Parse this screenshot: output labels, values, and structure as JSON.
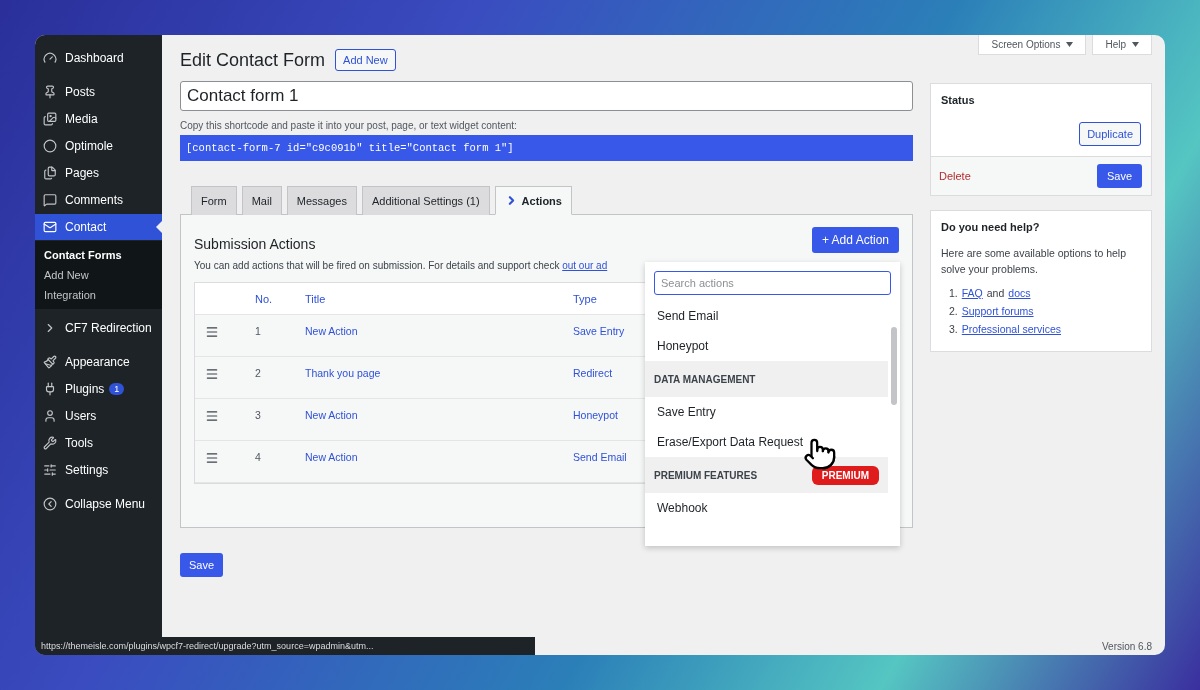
{
  "sidebar": {
    "items": [
      {
        "label": "Dashboard",
        "selected": false
      },
      {
        "label": "Posts",
        "selected": false
      },
      {
        "label": "Media",
        "selected": false
      },
      {
        "label": "Optimole",
        "selected": false
      },
      {
        "label": "Pages",
        "selected": false
      },
      {
        "label": "Comments",
        "selected": false
      },
      {
        "label": "Contact",
        "selected": true,
        "children": [
          {
            "label": "Contact Forms",
            "selected": true
          },
          {
            "label": "Add New",
            "selected": false
          },
          {
            "label": "Integration",
            "selected": false
          }
        ]
      },
      {
        "label": "CF7 Redirection",
        "selected": false
      },
      {
        "label": "Appearance",
        "selected": false
      },
      {
        "label": "Plugins",
        "selected": false,
        "badge": "1"
      },
      {
        "label": "Users",
        "selected": false
      },
      {
        "label": "Tools",
        "selected": false
      },
      {
        "label": "Settings",
        "selected": false
      },
      {
        "label": "Collapse Menu",
        "selected": false
      }
    ]
  },
  "top_buttons": [
    "Screen Options",
    "Help"
  ],
  "page_title": "Edit Contact Form",
  "add_new": "Add New",
  "form_title": "Contact form 1",
  "shortcode_hint": "Copy this shortcode and paste it into your post, page, or text widget content:",
  "shortcode": "[contact-form-7 id=\"c9c091b\" title=\"Contact form 1\"]",
  "tabs": [
    {
      "label": "Form",
      "selected": false
    },
    {
      "label": "Mail",
      "selected": false
    },
    {
      "label": "Messages",
      "selected": false
    },
    {
      "label": "Additional Settings (1)",
      "selected": false
    },
    {
      "label": "Actions",
      "selected": true
    }
  ],
  "actions": {
    "title": "Submission Actions",
    "add_button": "+ Add Action",
    "description": "You can add actions that will be fired on submission. For details and support check",
    "link": "out our ad",
    "columns": [
      "No.",
      "Title",
      "Type"
    ],
    "rows": [
      {
        "no": "1",
        "title": "New Action",
        "type": "Save Entry"
      },
      {
        "no": "2",
        "title": "Thank you page",
        "type": "Redirect"
      },
      {
        "no": "3",
        "title": "New Action",
        "type": "Honeypot"
      },
      {
        "no": "4",
        "title": "New Action",
        "type": "Send Email"
      }
    ]
  },
  "dropdown": {
    "placeholder": "Search actions",
    "entries": [
      {
        "kind": "item",
        "label": "Send Email"
      },
      {
        "kind": "item",
        "label": "Honeypot"
      },
      {
        "kind": "heading",
        "label": "DATA MANAGEMENT"
      },
      {
        "kind": "item",
        "label": "Save Entry"
      },
      {
        "kind": "item",
        "label": "Erase/Export Data Request"
      },
      {
        "kind": "heading",
        "label": "PREMIUM FEATURES",
        "badge": "PREMIUM"
      },
      {
        "kind": "item",
        "label": "Webhook"
      }
    ]
  },
  "save_button": "Save",
  "status_box": {
    "title": "Status",
    "duplicate": "Duplicate",
    "delete": "Delete",
    "save": "Save"
  },
  "help_box": {
    "title": "Do you need help?",
    "text": "Here are some available options to help solve your problems.",
    "links": [
      [
        {
          "kind": "link",
          "text": "FAQ"
        },
        {
          "kind": "text",
          "text": "and"
        },
        {
          "kind": "link",
          "text": "docs"
        }
      ],
      [
        {
          "kind": "link",
          "text": "Support forums"
        }
      ],
      [
        {
          "kind": "link",
          "text": "Professional services"
        }
      ]
    ],
    "numbers": [
      "1.",
      "2.",
      "3."
    ]
  },
  "status_url": "https://themeisle.com/plugins/wpcf7-redirect/upgrade?utm_source=wpadmin&utm...",
  "version": "Version 6.8"
}
